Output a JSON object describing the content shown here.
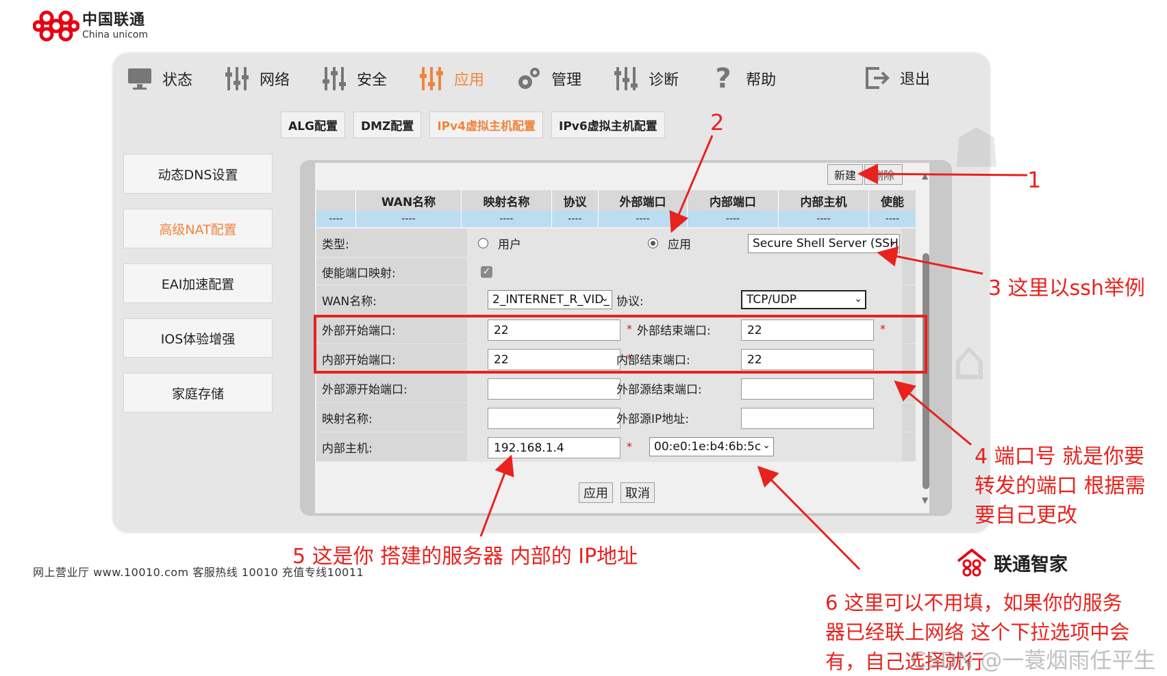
{
  "logo": {
    "name_cn": "中国联通",
    "name_en": "China unicom"
  },
  "nav": {
    "items": [
      {
        "label": "状态",
        "icon": "monitor-icon"
      },
      {
        "label": "网络",
        "icon": "sliders-icon"
      },
      {
        "label": "安全",
        "icon": "sliders-icon"
      },
      {
        "label": "应用",
        "icon": "sliders-icon",
        "active": true
      },
      {
        "label": "管理",
        "icon": "gear-icon"
      },
      {
        "label": "诊断",
        "icon": "sliders-icon"
      },
      {
        "label": "帮助",
        "icon": "question-icon"
      }
    ],
    "exit": "退出"
  },
  "subtabs": [
    "ALG配置",
    "DMZ配置",
    "IPv4虚拟主机配置",
    "IPv6虚拟主机配置"
  ],
  "sidebar": [
    "动态DNS设置",
    "高级NAT配置",
    "EAI加速配置",
    "IOS体验增强",
    "家庭存储"
  ],
  "actions": {
    "new": "新建",
    "delete": "删除"
  },
  "table": {
    "headers": [
      "",
      "WAN名称",
      "映射名称",
      "协议",
      "外部端口",
      "内部端口",
      "内部主机",
      "使能"
    ],
    "empty_row": [
      "----",
      "----",
      "----",
      "----",
      "----",
      "----",
      "----",
      "----"
    ]
  },
  "form": {
    "type_label": "类型:",
    "type_user": "用户",
    "type_app": "应用",
    "app_select": "Secure Shell Server (SSH",
    "enable_label": "使能端口映射:",
    "wan_label": "WAN名称:",
    "wan_select": "2_INTERNET_R_VID_",
    "protocol_label": "协议:",
    "protocol_select": "TCP/UDP",
    "ext_start_label": "外部开始端口:",
    "ext_start_value": "22",
    "ext_end_label": "外部结束端口:",
    "ext_end_value": "22",
    "int_start_label": "内部开始端口:",
    "int_start_value": "22",
    "int_end_label": "内部结束端口:",
    "int_end_value": "22",
    "src_start_label": "外部源开始端口:",
    "src_end_label": "外部源结束端口:",
    "map_name_label": "映射名称:",
    "src_ip_label": "外部源IP地址:",
    "host_label": "内部主机:",
    "host_value": "192.168.1.4",
    "mac_select": "00:e0:1e:b4:6b:5c",
    "required": "*"
  },
  "buttons": {
    "apply": "应用",
    "cancel": "取消"
  },
  "footer": "网上营业厅 www.10010.com  客服热线  10010  充值专线10011",
  "annotations": {
    "n1": "1",
    "n2": "2",
    "n3": "3 这里以ssh举例",
    "n4": [
      "4 端口号 就是你要",
      "转发的端口 根据需",
      "要自己更改"
    ],
    "n5": "5 这是你 搭建的服务器 内部的 IP地址",
    "n6": [
      "6 这里可以不用填，如果你的服务",
      "器已经联上网络 这个下拉选项中会",
      "有，自己选择就行"
    ]
  },
  "brand": "联通智家",
  "watermark": "CSDN @一蓑烟雨任平生z",
  "colors": {
    "accent": "#f0843c",
    "annotation": "#e8221d",
    "header_blue": "#bcdcf2"
  }
}
